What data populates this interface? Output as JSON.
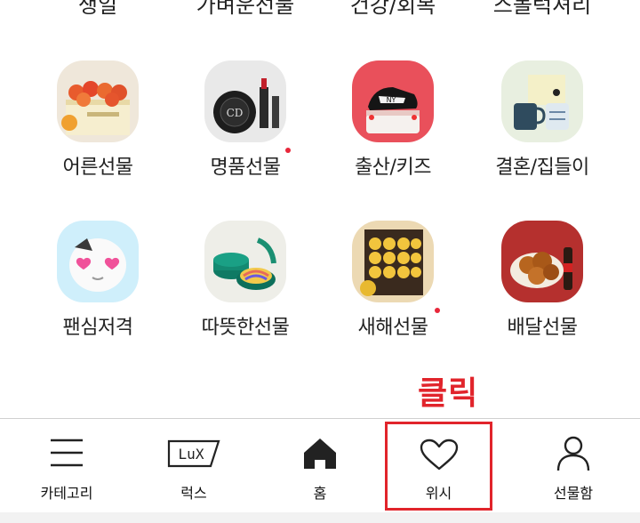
{
  "top_categories": [
    "생일",
    "가벼운선물",
    "건강/회복",
    "스몰럭셔리"
  ],
  "categories": [
    {
      "label": "어른선물",
      "icon": "fruit-gift-box-thumbnail",
      "new_dot": false
    },
    {
      "label": "명품선물",
      "icon": "luxury-cosmetics-thumbnail",
      "new_dot": true
    },
    {
      "label": "출산/키즈",
      "icon": "kids-sneaker-cake-thumbnail",
      "new_dot": false
    },
    {
      "label": "결혼/집들이",
      "icon": "mug-set-thumbnail",
      "new_dot": false
    },
    {
      "label": "팬심저격",
      "icon": "character-plush-thumbnail",
      "new_dot": false
    },
    {
      "label": "따뜻한선물",
      "icon": "tea-gift-set-thumbnail",
      "new_dot": false
    },
    {
      "label": "새해선물",
      "icon": "new-year-gift-box-thumbnail",
      "new_dot": true
    },
    {
      "label": "배달선물",
      "icon": "fried-chicken-thumbnail",
      "new_dot": false
    }
  ],
  "annotation": {
    "label": "클릭",
    "color": "#e1242b"
  },
  "bottom_nav": [
    {
      "label": "카테고리",
      "icon": "menu-icon"
    },
    {
      "label": "럭스",
      "icon": "lux-icon",
      "icon_text": "LuX"
    },
    {
      "label": "홈",
      "icon": "home-icon"
    },
    {
      "label": "위시",
      "icon": "heart-icon"
    },
    {
      "label": "선물함",
      "icon": "person-icon"
    }
  ],
  "colors": {
    "accent_red": "#e8273a",
    "annotation_red": "#e1242b",
    "divider": "#d0d0d0"
  }
}
